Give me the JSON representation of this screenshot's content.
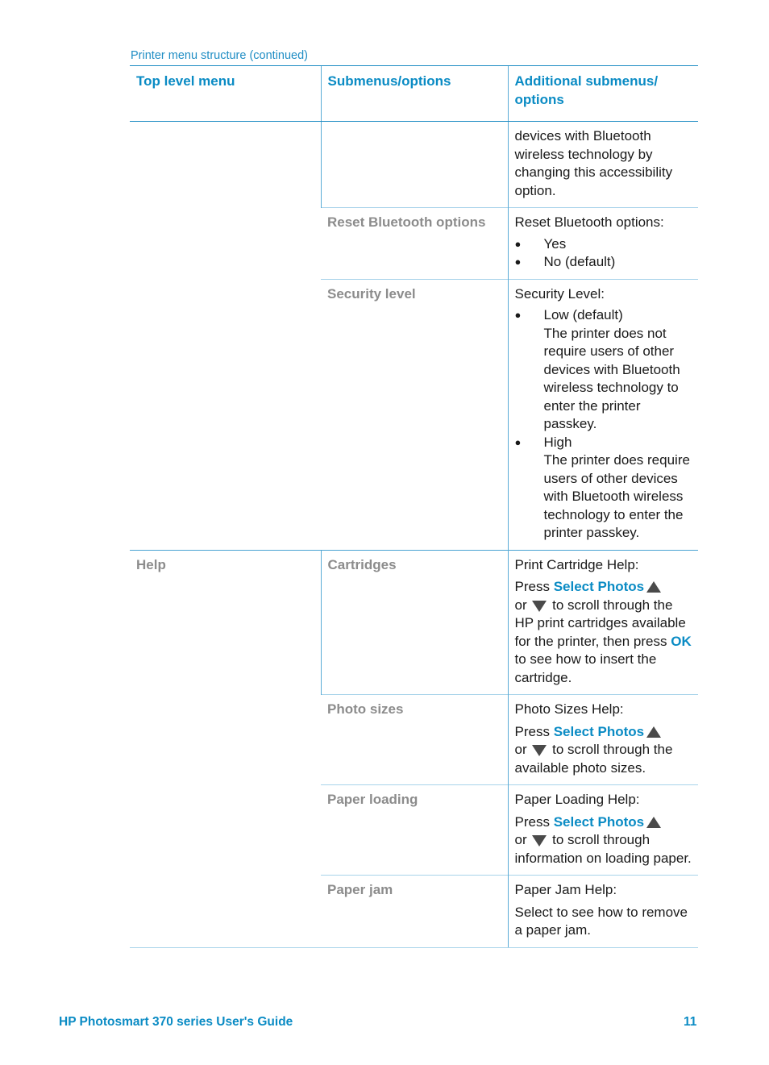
{
  "caption": "Printer menu structure (continued)",
  "headers": [
    "Top level menu",
    "Submenus/options",
    "Additional submenus/ options"
  ],
  "rows": {
    "r0": {
      "top": "",
      "sub": "",
      "text": "devices with Bluetooth wireless technology by changing this accessibility option."
    },
    "r1": {
      "sub": "Reset Bluetooth options",
      "intro": "Reset Bluetooth options:",
      "bullets": [
        "Yes",
        "No (default)"
      ]
    },
    "r2": {
      "sub": "Security level",
      "intro": "Security Level:",
      "bullets": [
        {
          "title": "Low (default)",
          "desc": "The printer does not require users of other devices with Bluetooth wireless technology to enter the printer passkey."
        },
        {
          "title": "High",
          "desc": "The printer does require users of other devices with Bluetooth wireless technology to enter the printer passkey."
        }
      ]
    },
    "r3": {
      "top": "Help",
      "sub": "Cartridges",
      "intro": "Print Cartridge Help:",
      "press": "Press",
      "button": "Select Photos",
      "or": "or",
      "rest": "to scroll through the HP print cartridges available for the printer, then press",
      "ok": "OK",
      "tail": "to see how to insert the cartridge."
    },
    "r4": {
      "sub": "Photo sizes",
      "intro": "Photo Sizes Help:",
      "press": "Press",
      "button": "Select Photos",
      "or": "or",
      "rest": "to scroll through the available photo sizes."
    },
    "r5": {
      "sub": "Paper loading",
      "intro": "Paper Loading Help:",
      "press": "Press",
      "button": "Select Photos",
      "or": "or",
      "rest": "to scroll through information on loading paper."
    },
    "r6": {
      "sub": "Paper jam",
      "intro": "Paper Jam Help:",
      "text": "Select to see how to remove a paper jam."
    }
  },
  "icons": {
    "up": "up-arrow-icon",
    "down": "down-arrow-icon"
  },
  "footer": {
    "title": "HP Photosmart 370 series User's Guide",
    "page": "11"
  },
  "colors": {
    "accent": "#0a8bc4",
    "grey_label": "#8c8c8c",
    "rule": "#4aa3d3"
  }
}
